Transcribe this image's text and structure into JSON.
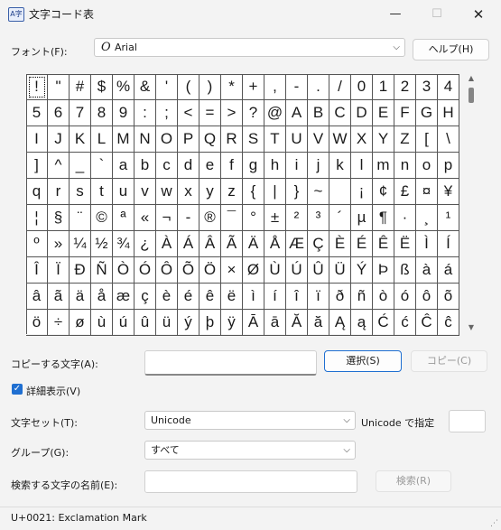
{
  "window": {
    "title": "文字コード表",
    "icon_label": "A字",
    "minimize_glyph": "—",
    "maximize_glyph": "☐",
    "close_glyph": "✕"
  },
  "font_row": {
    "label": "フォント(F):",
    "selected_font": "Arial",
    "font_glyph": "O",
    "chevron": "⌵",
    "help_button": "ヘルプ(H)"
  },
  "char_grid": {
    "selected_index": 0,
    "cells": [
      "!",
      "\"",
      "#",
      "$",
      "%",
      "&",
      "'",
      "(",
      ")",
      "*",
      "+",
      ",",
      "-",
      ".",
      "/",
      "0",
      "1",
      "2",
      "3",
      "4",
      "5",
      "6",
      "7",
      "8",
      "9",
      ":",
      ";",
      "<",
      "=",
      ">",
      "?",
      "@",
      "A",
      "B",
      "C",
      "D",
      "E",
      "F",
      "G",
      "H",
      "I",
      "J",
      "K",
      "L",
      "M",
      "N",
      "O",
      "P",
      "Q",
      "R",
      "S",
      "T",
      "U",
      "V",
      "W",
      "X",
      "Y",
      "Z",
      "[",
      "\\",
      "]",
      "^",
      "_",
      "`",
      "a",
      "b",
      "c",
      "d",
      "e",
      "f",
      "g",
      "h",
      "i",
      "j",
      "k",
      "l",
      "m",
      "n",
      "o",
      "p",
      "q",
      "r",
      "s",
      "t",
      "u",
      "v",
      "w",
      "x",
      "y",
      "z",
      "{",
      "|",
      "}",
      "~",
      " ",
      "¡",
      "¢",
      "£",
      "¤",
      "¥",
      "¦",
      "§",
      "¨",
      "©",
      "ª",
      "«",
      "¬",
      "-",
      "®",
      "¯",
      "°",
      "±",
      "²",
      "³",
      "´",
      "µ",
      "¶",
      "·",
      "¸",
      "¹",
      "º",
      "»",
      "¼",
      "½",
      "¾",
      "¿",
      "À",
      "Á",
      "Â",
      "Ã",
      "Ä",
      "Å",
      "Æ",
      "Ç",
      "È",
      "É",
      "Ê",
      "Ë",
      "Ì",
      "Í",
      "Î",
      "Ï",
      "Ð",
      "Ñ",
      "Ò",
      "Ó",
      "Ô",
      "Õ",
      "Ö",
      "×",
      "Ø",
      "Ù",
      "Ú",
      "Û",
      "Ü",
      "Ý",
      "Þ",
      "ß",
      "à",
      "á",
      "â",
      "ã",
      "ä",
      "å",
      "æ",
      "ç",
      "è",
      "é",
      "ê",
      "ë",
      "ì",
      "í",
      "î",
      "ï",
      "ð",
      "ñ",
      "ò",
      "ó",
      "ô",
      "õ",
      "ö",
      "÷",
      "ø",
      "ù",
      "ú",
      "û",
      "ü",
      "ý",
      "þ",
      "ÿ",
      "Ā",
      "ā",
      "Ă",
      "ă",
      "Ą",
      "ą",
      "Ć",
      "ć",
      "Ĉ",
      "ĉ"
    ]
  },
  "copy_row": {
    "label": "コピーする文字(A):",
    "value": "",
    "select_button": "選択(S)",
    "copy_button": "コピー(C)"
  },
  "advanced": {
    "checkbox_label": "詳細表示(V)",
    "checked": true,
    "check_glyph": "✓"
  },
  "charset_row": {
    "label": "文字セット(T):",
    "value": "Unicode",
    "goto_label": "Unicode で指定",
    "goto_value": ""
  },
  "group_row": {
    "label": "グループ(G):",
    "value": "すべて"
  },
  "search_row": {
    "label": "検索する文字の名前(E):",
    "value": "",
    "search_button": "検索(R)"
  },
  "status": {
    "text": "U+0021: Exclamation Mark"
  },
  "colors": {
    "accent": "#1f6fd1",
    "window_bg": "#f3f3f3",
    "grid_line": "#555555"
  }
}
